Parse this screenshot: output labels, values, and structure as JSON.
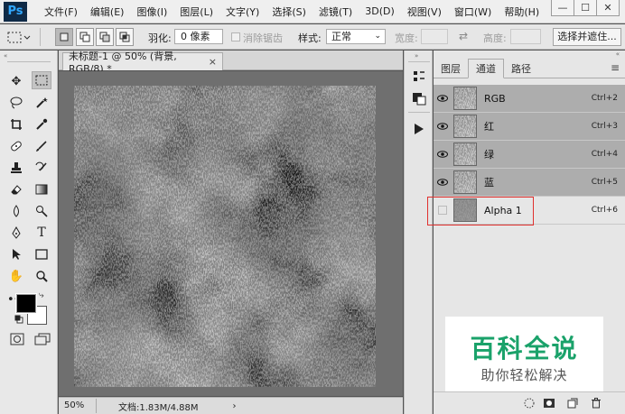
{
  "app": {
    "logo": "Ps"
  },
  "menu": [
    "文件(F)",
    "编辑(E)",
    "图像(I)",
    "图层(L)",
    "文字(Y)",
    "选择(S)",
    "滤镜(T)",
    "3D(D)",
    "视图(V)",
    "窗口(W)",
    "帮助(H)"
  ],
  "window_controls": {
    "minimize": "—",
    "maximize": "☐",
    "close": "✕"
  },
  "options": {
    "feather_label": "羽化:",
    "feather_value": "0 像素",
    "antialias_label": "消除锯齿",
    "style_label": "样式:",
    "style_value": "正常",
    "width_label": "宽度:",
    "height_label": "高度:",
    "select_mask_button": "选择并遮住..."
  },
  "document": {
    "tab_title": "未标题-1 @ 50% (背景, RGB/8) *",
    "tab_close": "×",
    "zoom": "50%",
    "doc_size": "文档:1.83M/4.88M",
    "status_arrow": "›"
  },
  "panel": {
    "tabs": [
      "图层",
      "通道",
      "路径"
    ],
    "active_tab": 1,
    "channels": [
      {
        "name": "RGB",
        "shortcut": "Ctrl+2",
        "visible": true,
        "selected": true
      },
      {
        "name": "红",
        "shortcut": "Ctrl+3",
        "visible": true,
        "selected": true
      },
      {
        "name": "绿",
        "shortcut": "Ctrl+4",
        "visible": true,
        "selected": true
      },
      {
        "name": "蓝",
        "shortcut": "Ctrl+5",
        "visible": true,
        "selected": true
      },
      {
        "name": "Alpha 1",
        "shortcut": "Ctrl+6",
        "visible": false,
        "selected": false
      }
    ]
  },
  "watermark": {
    "title": "百科全说",
    "subtitle": "助你轻松解决"
  },
  "colors": {
    "highlight": "#e0302e",
    "watermark_green": "#1aa26a",
    "selected_row": "#adadad"
  }
}
